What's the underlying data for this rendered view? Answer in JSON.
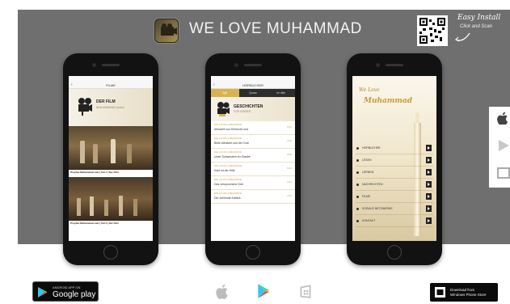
{
  "header": {
    "app_title": "WE LOVE MUHAMMAD",
    "easy_install": "Easy Install",
    "click_and_scan": "Click and Scan"
  },
  "phone1": {
    "nav_title": "FILME",
    "film_title": "DER FILM",
    "film_subtitle": "MUHAMMAD (saw)",
    "video1_caption": "Prophet Muhammad saw | Teil 1 | Der Film",
    "video2_caption": "Prophet Muhammad saw | Teil 2 | Der Film"
  },
  "phone2": {
    "nav_title": "HÖRBUCHER",
    "tabs": [
      "Alle",
      "Quran",
      "Im Alte"
    ],
    "section_title": "GESCHICHTEN",
    "section_subtitle": "FÜR KINDER",
    "stories": [
      {
        "category": "DIE LAUTE & BEGRIFFE",
        "title": "Allmacht von Ehrfurcht und",
        "time": "3:45"
      },
      {
        "category": "DIE LAUTE & BEGRIFFE",
        "title": "Biete Allmacht und der Gott",
        "time": "4:10"
      },
      {
        "category": "DIE LAUTE & BEGRIFFE",
        "title": "Unter Schwestern im Glaube",
        "time": "2:58"
      },
      {
        "category": "DIE LAUTE & BEGRIFFE",
        "title": "Kant ist der Hilfe",
        "time": "5:02"
      },
      {
        "category": "DIE LAUTE & BEGRIFFE",
        "title": "Das versprochene Geb",
        "time": "3:21"
      },
      {
        "category": "DIE LAUTE & BEGRIFFE",
        "title": "Der schönste Anblick",
        "time": "4:40"
      }
    ]
  },
  "phone3": {
    "logo_small": "We",
    "logo_love": "Love",
    "logo_name": "Muhammad",
    "menu": [
      "HÖRBUCHER",
      "LESEN",
      "LERNEN",
      "NACHRICHTEN",
      "FILME",
      "SOZIALE NETZWERKE",
      "KONTAKT"
    ]
  },
  "badges": {
    "google_small": "ANDROID APP ON",
    "google_big": "Google play",
    "windows_line1": "Download from",
    "windows_line2": "Windows Phone Store"
  },
  "side_icons": [
    "apple-icon",
    "play-store-icon",
    "windows-icon"
  ],
  "colors": {
    "banner": "#6f6f6f",
    "gold": "#d8b451",
    "phone": "#121212"
  }
}
